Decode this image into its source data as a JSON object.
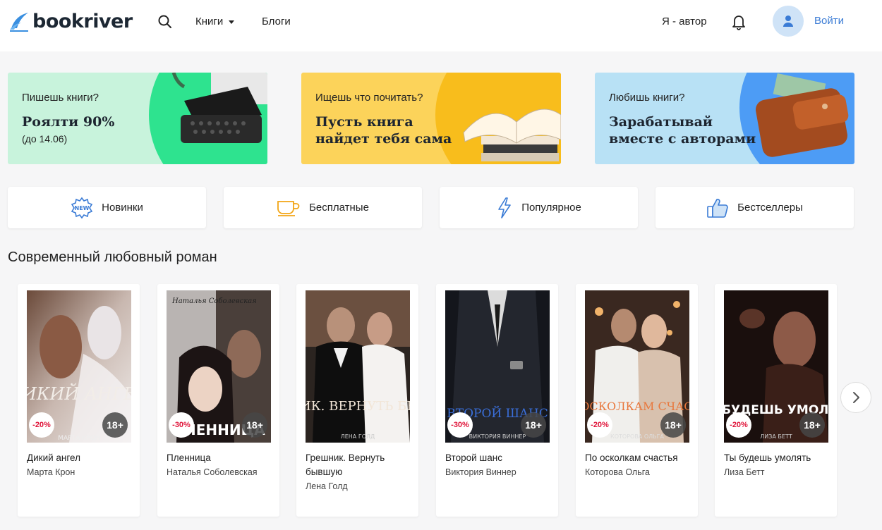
{
  "header": {
    "logo": "bookriver",
    "nav_books": "Книги",
    "nav_blogs": "Блоги",
    "nav_author": "Я - автор",
    "login": "Войти"
  },
  "banners": [
    {
      "small": "Пишешь книги?",
      "big": "Роялти 90%",
      "sub": "(до 14.06)"
    },
    {
      "small": "Ищешь что почитать?",
      "big_line1": "Пусть книга",
      "big_line2": "найдет тебя сама"
    },
    {
      "small": "Любишь книги?",
      "big_line1": "Зарабатывай",
      "big_line2": "вместе с авторами"
    }
  ],
  "categories": [
    {
      "label": "Новинки",
      "icon": "new-badge-icon"
    },
    {
      "label": "Бесплатные",
      "icon": "cup-icon"
    },
    {
      "label": "Популярное",
      "icon": "lightning-icon"
    },
    {
      "label": "Бестселлеры",
      "icon": "thumbs-up-icon"
    }
  ],
  "section_title": "Современный любовный роман",
  "books": [
    {
      "title": "Дикий ангел",
      "author": "Марта Крон",
      "discount": "-20%",
      "age": "18+",
      "cover_title": "ДИКИЙ АНГЕЛ",
      "cover_author": "МАРТА КРОН"
    },
    {
      "title": "Пленница",
      "author": "Наталья Соболевская",
      "discount": "-30%",
      "age": "18+",
      "cover_title": "ПЛЕННИЦА",
      "cover_author": "Наталья Соболевская"
    },
    {
      "title": "Грешник. Вернуть бывшую",
      "author": "Лена Голд",
      "cover_title": "ГРЕШНИК. ВЕРНУТЬ БЫВШУЮ",
      "cover_author": "ЛЕНА ГОЛД"
    },
    {
      "title": "Второй шанс",
      "author": "Виктория Виннер",
      "discount": "-30%",
      "age": "18+",
      "cover_title": "ВТОРОЙ ШАНС",
      "cover_author": "ВИКТОРИЯ ВИННЕР"
    },
    {
      "title": "По осколкам счастья",
      "author": "Которова Ольга",
      "discount": "-20%",
      "age": "18+",
      "cover_title": "ПО ОСКОЛКАМ СЧАСТЬЯ",
      "cover_author": "КОТОРОВА ОЛЬГА"
    },
    {
      "title": "Ты будешь умолять",
      "author": "Лиза Бетт",
      "discount": "-20%",
      "age": "18+",
      "cover_title": "ТЫ БУДЕШЬ УМОЛЯТЬ",
      "cover_author": "ЛИЗА БЕТТ"
    }
  ],
  "colors": {
    "accent": "#3a7bd5",
    "discount": "#e0153a"
  }
}
